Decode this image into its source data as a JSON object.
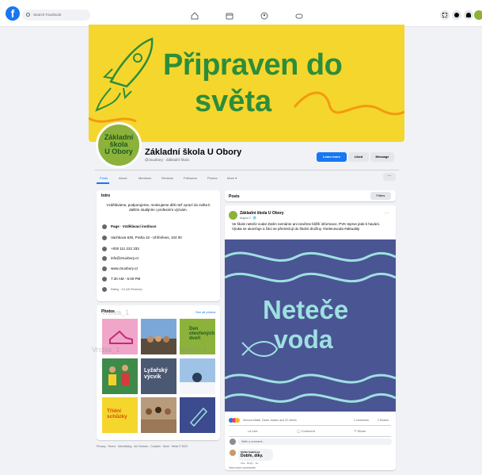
{
  "topbar": {
    "logo": "f",
    "search_placeholder": "Search Facebook",
    "nav_icons": [
      "home-icon",
      "marketplace-icon",
      "groups-icon",
      "gaming-icon"
    ],
    "right_icons": [
      "menu-icon",
      "messenger-icon",
      "notifications-icon",
      "account-icon"
    ]
  },
  "cover": {
    "line1": "Připraven do",
    "line2": "světa"
  },
  "page": {
    "avatar_text": [
      "Základní",
      "škola",
      "U Obory"
    ],
    "name": "Základní škola U Obory",
    "subtitle": "@zsuobory · Základní škola",
    "btn_learn": "Learn more",
    "btn_liked": "Liked",
    "btn_message": "Message",
    "more": "···"
  },
  "tabs": [
    "Posts",
    "About",
    "Mentions",
    "Reviews",
    "Followers",
    "Photos",
    "More ▾"
  ],
  "intro": {
    "title": "Intro",
    "text": "Vzděláváme, podporujeme, motivujeme děti než vyrazí do světa k dalším studijním i profesním výzvám.",
    "rows": [
      "Page · Vzdělávací instituce",
      "Vachkova 630, Praha 10 - Uhříněves, 104 00",
      "+000 111 222 333",
      "info@zsuobory.cz",
      "www.zsuobory.cz",
      "7:30 AM - 5:00 PM",
      "Rating · 4.8 (46 Reviews)"
    ]
  },
  "photos": {
    "title": "Photos",
    "see_all": "See all photos",
    "tiles": [
      "",
      "",
      "Den otevřených dveří",
      "",
      "Lyžařský výcvik",
      "",
      "Třídní schůzky",
      "",
      ""
    ]
  },
  "footer": "Privacy · Terms · Advertising · Ad Choices · Cookies · More · Meta © 2022",
  "watermarks": [
    "Vrstva_1",
    "Vrstva_1",
    "Vrstva_1"
  ],
  "posts": {
    "title": "Posts",
    "filters": "Filters",
    "author": "Základní škola U Obory",
    "time": "August 2 · 🌐",
    "text": "Ve škole neteče voda! Zatím nemáme ani nevěme bližší informace, PVK teprve jede k havárii. Výuka se ukončuje a žáci se přemisťují do školní družiny. #netecevoda #aktuality",
    "image_line1": "Neteče",
    "image_line2": "voda",
    "reactions": "Simona Málek, David Jansen and 22 others",
    "comments_count": "2 comments",
    "shares_count": "2 Shares",
    "like": "Like",
    "comment": "Comment",
    "share": "Share",
    "write_comment": "Write a comment...",
    "comment_author": "Stefka Gajarkova",
    "comment_text": "Dobře, díky.",
    "comment_meta": "Like · Reply · 1w",
    "view_more": "View more comments"
  },
  "colors": {
    "cover_bg": "#f5d62d",
    "cover_text": "#2c8d3b",
    "post_img_bg": "#4a5593",
    "post_img_text": "#9ee0e1",
    "accent": "#1877f2"
  }
}
